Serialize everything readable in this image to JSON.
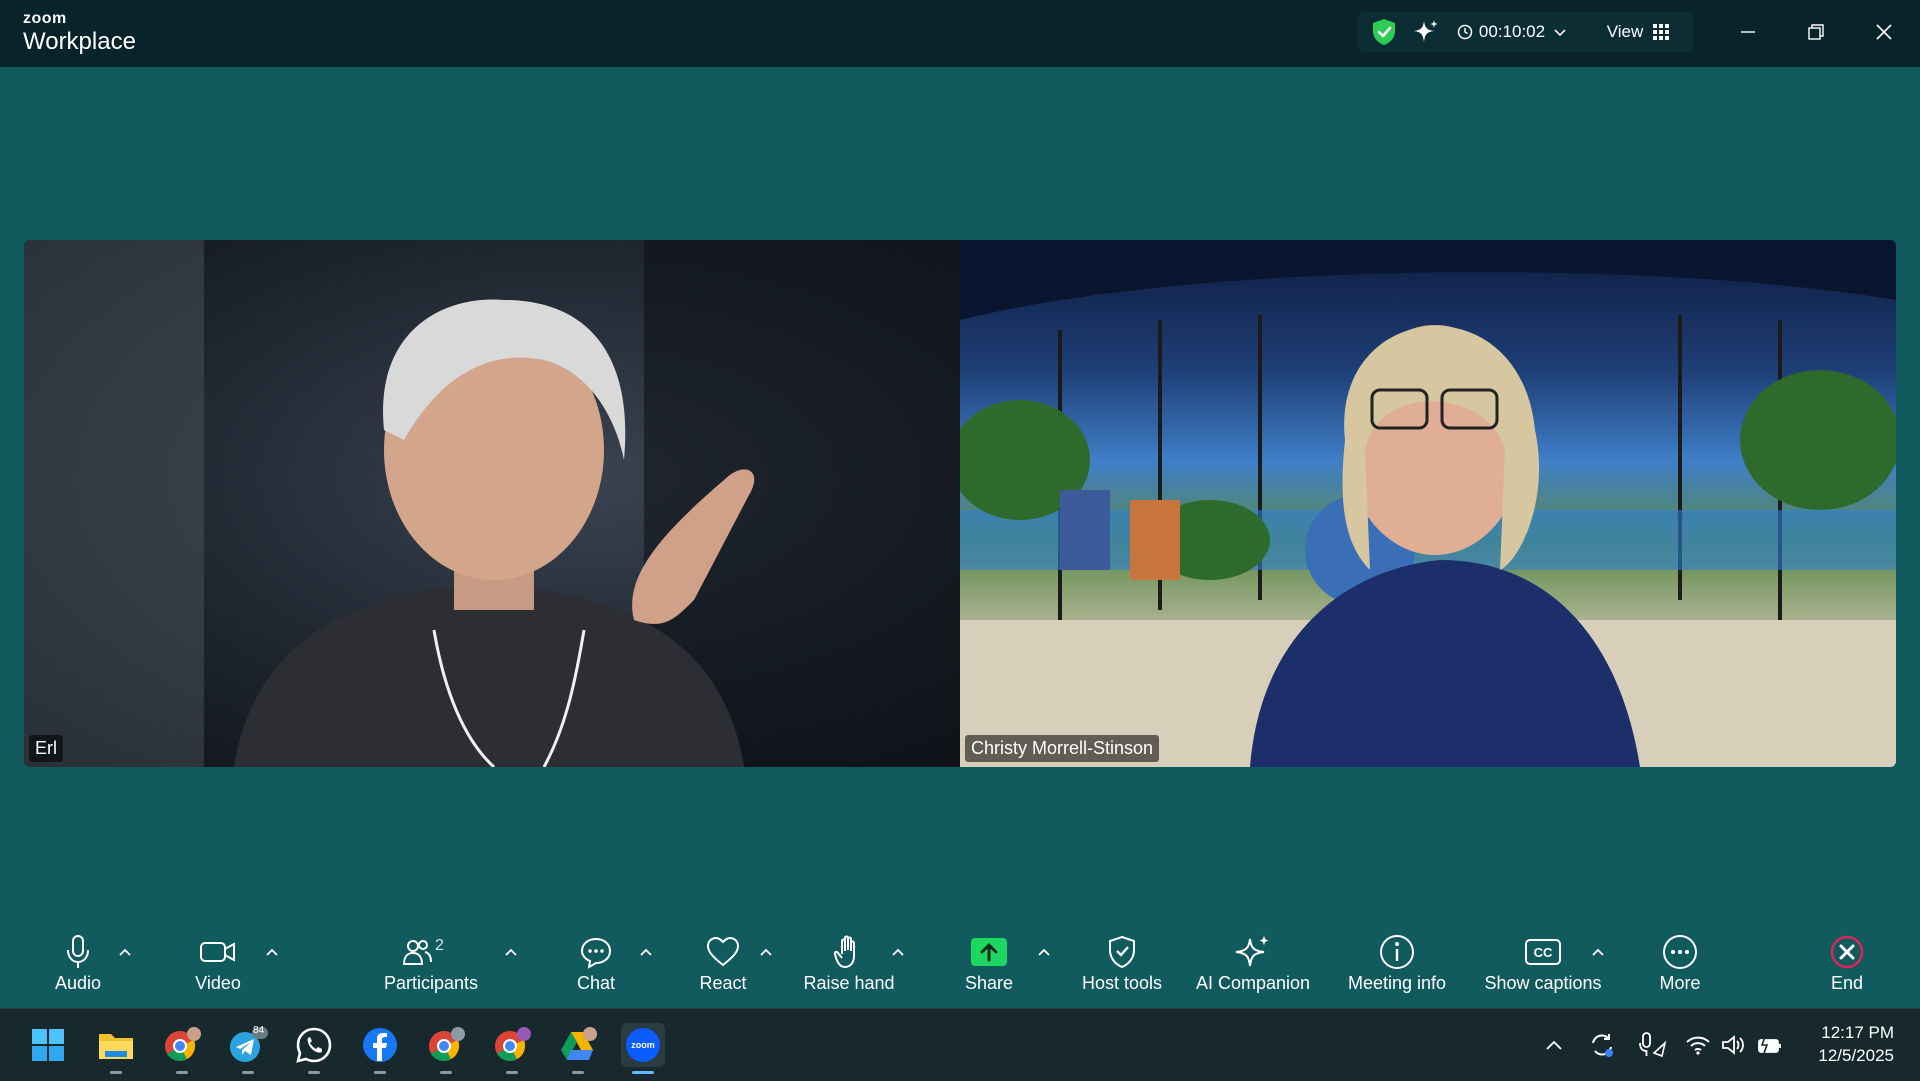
{
  "app": {
    "brand_small": "zoom",
    "brand_big": "Workplace"
  },
  "titlebar": {
    "timer": "00:10:02",
    "view_label": "View"
  },
  "participants_video": [
    {
      "name": "Erl"
    },
    {
      "name": "Christy Morrell-Stinson"
    }
  ],
  "toolbar": {
    "audio": "Audio",
    "video": "Video",
    "participants": "Participants",
    "participants_count": "2",
    "chat": "Chat",
    "react": "React",
    "raise_hand": "Raise hand",
    "share": "Share",
    "host_tools": "Host tools",
    "ai_companion": "AI Companion",
    "meeting_info": "Meeting info",
    "show_captions": "Show captions",
    "more": "More",
    "end": "End"
  },
  "taskbar": {
    "telegram_badge": "84",
    "time": "12:17 PM",
    "date": "12/5/2025",
    "zoom_icon_text": "zoom"
  },
  "colors": {
    "stage_bg": "#115a5d",
    "titlebar_bg": "#08232a",
    "share_green": "#1ed760",
    "end_red": "#e0245e",
    "shield_green": "#2ecc55"
  }
}
